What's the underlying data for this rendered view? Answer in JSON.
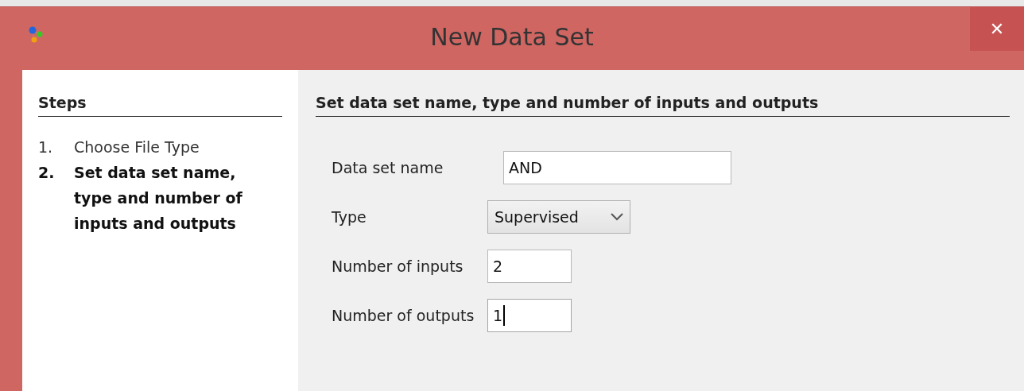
{
  "window": {
    "title": "New Data Set",
    "close": "✕"
  },
  "steps": {
    "heading": "Steps",
    "items": [
      {
        "number": "1.",
        "label": "Choose File Type",
        "selected": false
      },
      {
        "number": "2.",
        "label": "Set data set name, type and number of inputs and outputs",
        "selected": true
      }
    ]
  },
  "form": {
    "heading": "Set data set name, type and number of inputs and outputs",
    "fields": [
      {
        "kind": "name",
        "label": "Data set name",
        "value": "AND",
        "focused": false
      },
      {
        "kind": "dropdown",
        "label": "Type",
        "value": "Supervised"
      },
      {
        "kind": "number",
        "label": "Number of inputs",
        "value": "2",
        "focused": false
      },
      {
        "kind": "number",
        "label": "Number of outputs",
        "value": "1",
        "focused": true
      }
    ]
  }
}
